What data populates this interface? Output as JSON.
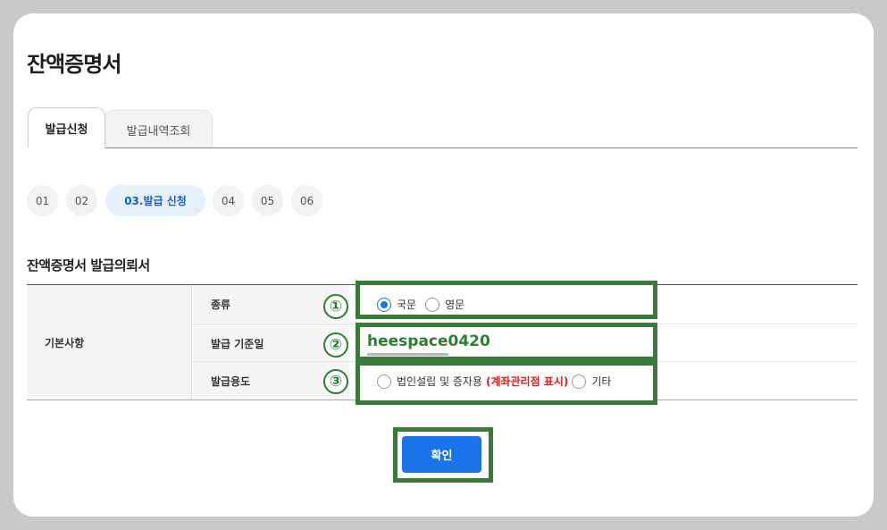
{
  "page": {
    "title": "잔액증명서"
  },
  "tabs": [
    {
      "label": "발급신청",
      "active": true
    },
    {
      "label": "발급내역조회",
      "active": false
    }
  ],
  "steps": [
    "01",
    "02",
    "03.발급 신청",
    "04",
    "05",
    "06"
  ],
  "section": {
    "title": "잔액증명서 발급의뢰서"
  },
  "form": {
    "group_label": "기본사항",
    "rows": [
      {
        "label": "종류",
        "marker": "①"
      },
      {
        "label": "발급 기준일",
        "marker": "②"
      },
      {
        "label": "발급용도",
        "marker": "③"
      }
    ],
    "type_options": [
      "국문",
      "영문"
    ],
    "type_selected": "국문",
    "base_date_value": "heespace0420",
    "purpose_options": {
      "option1_prefix": "법인설립 및 증자용",
      "option1_highlight": "(계좌관리점 표시)",
      "option2": "기타"
    }
  },
  "confirm_label": "확인",
  "colors": {
    "accent": "#1a73e8",
    "annotation": "#3b7a3b",
    "highlight": "#e02020"
  }
}
